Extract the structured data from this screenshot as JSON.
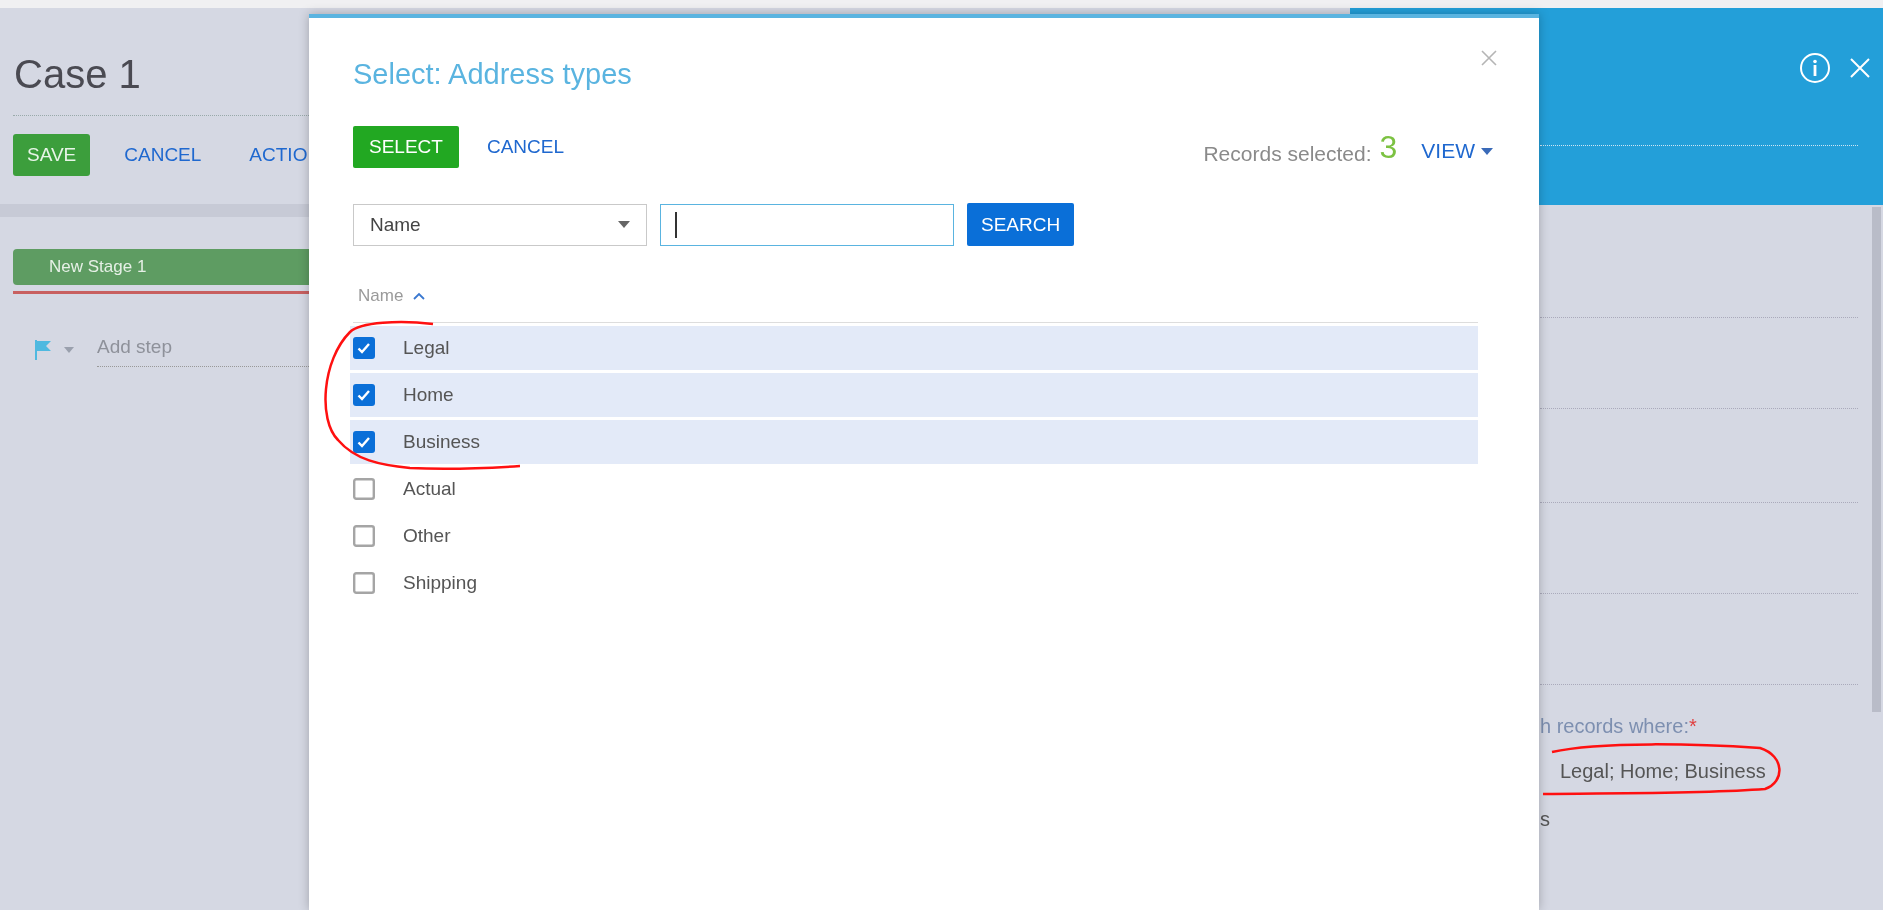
{
  "page": {
    "title": "Case 1",
    "actions": [
      {
        "label": "SAVE",
        "kind": "primary"
      },
      {
        "label": "CANCEL",
        "kind": "link"
      },
      {
        "label": "ACTIO",
        "kind": "link"
      }
    ],
    "stage": "New Stage 1",
    "step": {
      "placeholder": "Add step"
    }
  },
  "dialog": {
    "title": "Select: Address types",
    "buttons": [
      {
        "label": "SELECT",
        "kind": "primary"
      },
      {
        "label": "CANCEL",
        "kind": "link"
      }
    ],
    "records_label": "Records selected:",
    "records_count": "3",
    "view": "VIEW",
    "filter": {
      "column": "Name",
      "search": "SEARCH"
    },
    "column": "Name",
    "rows": [
      {
        "name": "Legal",
        "checked": true
      },
      {
        "name": "Home",
        "checked": true
      },
      {
        "name": "Business",
        "checked": true
      },
      {
        "name": "Actual",
        "checked": false
      },
      {
        "name": "Other",
        "checked": false
      },
      {
        "name": "Shipping",
        "checked": false
      }
    ]
  },
  "side_panel": {
    "condition_label": "h records where:",
    "required_mark": "*",
    "condition_value": "Legal; Home; Business",
    "fragment": "s"
  }
}
